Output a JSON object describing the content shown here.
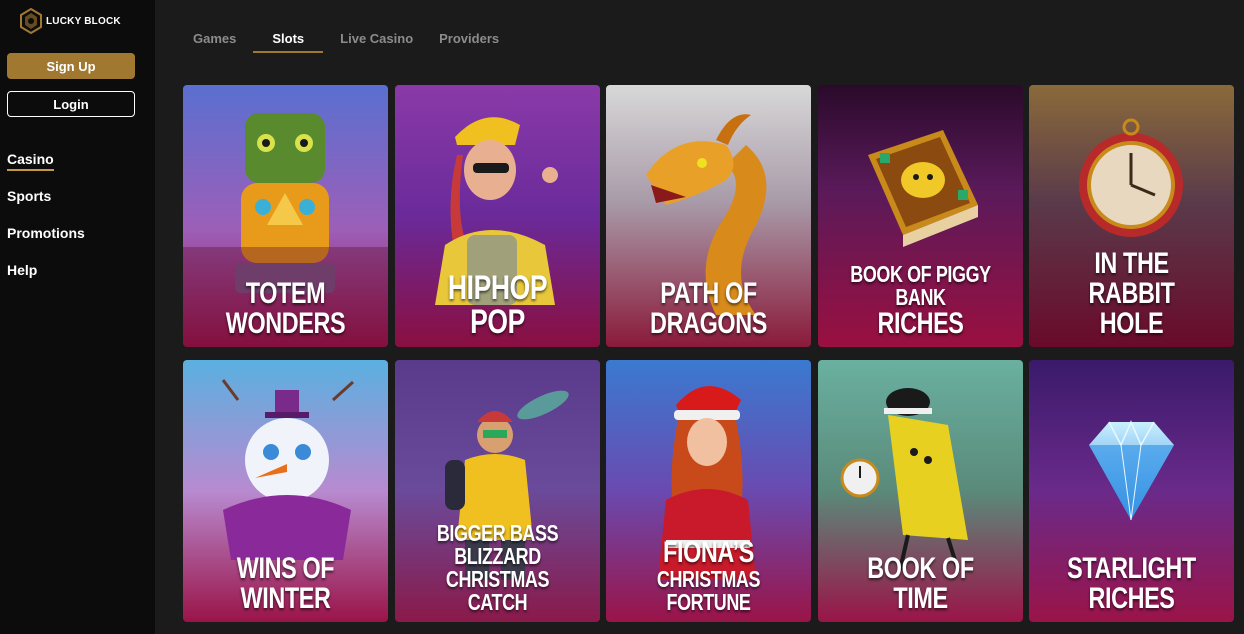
{
  "brand": {
    "name": "LUCKY BLOCK",
    "accent": "#a1782f"
  },
  "auth": {
    "signup_label": "Sign Up",
    "login_label": "Login"
  },
  "nav": {
    "items": [
      {
        "label": "Casino",
        "active": true
      },
      {
        "label": "Sports"
      },
      {
        "label": "Promotions"
      },
      {
        "label": "Help"
      }
    ]
  },
  "tabs": [
    {
      "label": "Games"
    },
    {
      "label": "Slots",
      "active": true
    },
    {
      "label": "Live Casino"
    },
    {
      "label": "Providers"
    }
  ],
  "games": [
    {
      "line1": "TOTEM WONDERS",
      "line2": "",
      "art": "totem-art"
    },
    {
      "line1": "HIPHOP POP",
      "line2": "",
      "art": "hiphop-art"
    },
    {
      "line1": "PATH OF DRAGONS",
      "line2": "",
      "art": "dragon-art"
    },
    {
      "line1": "BOOK OF PIGGY BANK",
      "line2": "RICHES",
      "art": "piggy-book-art"
    },
    {
      "line1": "IN THE RABBIT",
      "line2": "HOLE",
      "art": "pocket-watch-art"
    },
    {
      "line1": "WINS OF WINTER",
      "line2": "",
      "art": "snowman-art"
    },
    {
      "line1": "BIGGER BASS BLIZZARD",
      "line2": "CHRISTMAS CATCH",
      "art": "fisherman-art"
    },
    {
      "line1": "FIONA’S",
      "line2": "CHRISTMAS FORTUNE",
      "art": "fiona-art"
    },
    {
      "line1": "BOOK OF TIME",
      "line2": "",
      "art": "book-character-art"
    },
    {
      "line1": "STARLIGHT RICHES",
      "line2": "",
      "art": "diamond-art"
    }
  ]
}
